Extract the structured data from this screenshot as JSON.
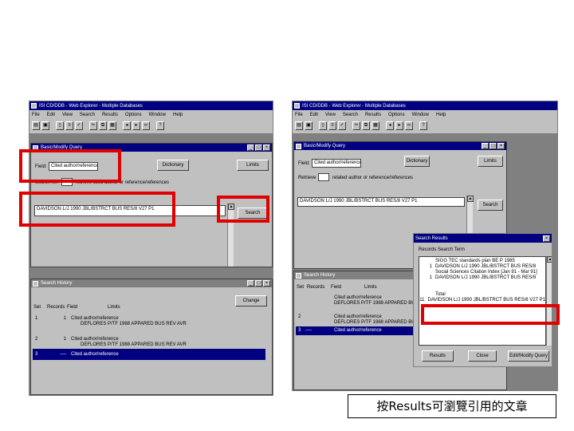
{
  "left_app": {
    "title": "ISI CD/DDB - Web Explorer - Multiple Databases",
    "menu": [
      "File",
      "Edit",
      "View",
      "Search",
      "Results",
      "Options",
      "Window",
      "Help"
    ],
    "query_window": {
      "title": "Basic/Modify Query",
      "field_label": "Field:",
      "field_value": "Cited author/reference",
      "dictionary_button": "Dictionary",
      "limits_button": "Limits",
      "search_for_label": "Search for:",
      "search_for_hint": "retrieve cited author or reference/references",
      "query_text": "DAVIDSON L/J 1990 JBL/BSTRCT BUS RES/8 V27 P1",
      "search_button": "Search"
    },
    "history_window": {
      "title": "Search History",
      "change_button": "Change",
      "columns": [
        "Set",
        "Records",
        "Field",
        "Limits"
      ],
      "rows": [
        {
          "set": "1",
          "records": "1",
          "field": "Cited author/reference",
          "detail": "DEFLORES P/TF 1988 APPARED BUS REV AVR"
        },
        {
          "set": "2",
          "records": "1",
          "field": "Cited author/reference",
          "detail": "DEFLORES P/TF 1988 APPARED BUS REV AVR"
        },
        {
          "set": "3",
          "records": "----",
          "field": "Cited author/reference",
          "detail": ""
        }
      ]
    }
  },
  "right_app": {
    "title": "ISI CD/DDB - Web Explorer - Multiple Databases",
    "menu": [
      "File",
      "Edit",
      "View",
      "Search",
      "Results",
      "Options",
      "Window",
      "Help"
    ],
    "query_window": {
      "title": "Basic/Modify Query",
      "field_label": "Field:",
      "field_value": "Cited author/reference",
      "dictionary_button": "Dictionary",
      "limits_button": "Limits",
      "search_for_label": "Retrieve",
      "search_for_hint": "related author or reference/references",
      "query_text": "DAVIDSON L/J 1990 JBL/BSTRCT BUS RES/8 V27 P1",
      "search_button": "Search"
    },
    "history_window": {
      "title": "Search History",
      "columns": [
        "Set",
        "Records",
        "Field",
        "Limits"
      ],
      "rows": [
        {
          "set": "",
          "records": "",
          "field": "Cited author/reference",
          "detail": "DEFLORES P/TF 1988 APPARED BUS REV AVR"
        },
        {
          "set": "2",
          "records": "",
          "field": "Cited author/reference",
          "detail": "DEFLORES P/TF 1988 APPARED BUS REV AVR"
        },
        {
          "set": "3",
          "records": "----",
          "field": "Cited author/reference",
          "detail": ""
        }
      ]
    },
    "results_dialog": {
      "title": "Search Results",
      "header": "Records  Search Term",
      "items": [
        {
          "mark": "",
          "text": "SIGG TEC standards plan BE P 1985"
        },
        {
          "mark": "1",
          "text": "DAVIDSON L/J 1990 JBL/BSTRCT BUS RES/8"
        },
        {
          "mark": "",
          "text": "Social Sciences Citation Index [Jan 91 - Mar 91]"
        },
        {
          "mark": "1",
          "text": "DAVIDSON L/J 1990 JBL/BSTRCT BUS RES/8"
        },
        {
          "mark": "",
          "text": ""
        },
        {
          "mark": "",
          "text": "Total"
        },
        {
          "mark": "11",
          "text": "DAVIDSON L/J 1990 JBL/BSTRCT BUS RES/8 V27 P1"
        }
      ],
      "results_button": "Results",
      "close_button": "Close",
      "edit_button": "Edit/Modify Query"
    }
  },
  "caption": "按Results可瀏覽引用的文章"
}
